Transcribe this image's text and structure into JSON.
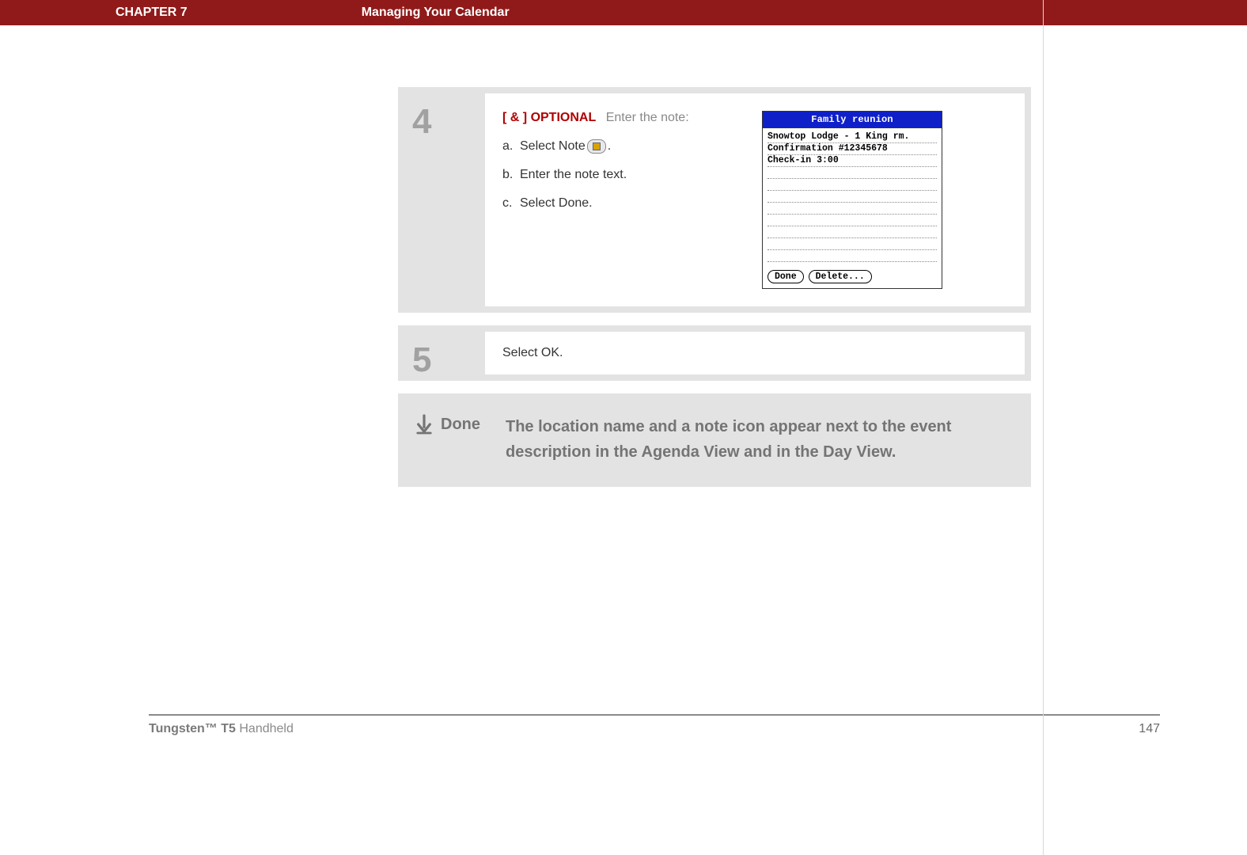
{
  "header": {
    "chapter_label": "CHAPTER 7",
    "chapter_title": "Managing Your Calendar"
  },
  "steps": {
    "step4": {
      "num": "4",
      "opt_prefix": "[ & ]",
      "opt_label": "OPTIONAL",
      "instruction": "Enter the note:",
      "a_marker": "a.",
      "a_text_before_icon": "Select Note ",
      "a_text_after_icon": ".",
      "b_marker": "b.",
      "b_text": "Enter the note text.",
      "c_marker": "c.",
      "c_text": "Select Done."
    },
    "step5": {
      "num": "5",
      "text": "Select OK."
    }
  },
  "palm": {
    "title": "Family reunion",
    "lines": [
      "Snowtop Lodge - 1 King rm.",
      "Confirmation #12345678",
      "Check-in 3:00",
      "",
      "",
      "",
      "",
      "",
      "",
      "",
      ""
    ],
    "btn_done": "Done",
    "btn_delete": "Delete..."
  },
  "done": {
    "label": "Done",
    "text": "The location name and a note icon appear next to the event description in the Agenda View and in the Day View."
  },
  "footer": {
    "product_bold": "Tungsten™ T5",
    "product_rest": " Handheld",
    "page": "147"
  }
}
